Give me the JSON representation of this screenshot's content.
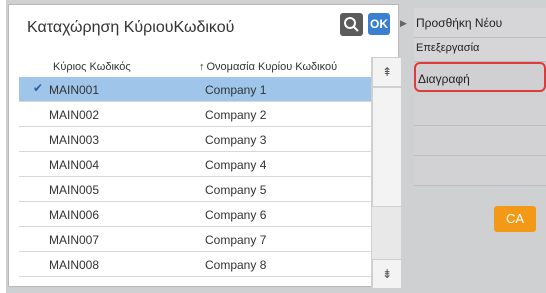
{
  "dialog": {
    "title": "Καταχώρηση ΚύριουΚωδικού",
    "ok_label": "OK"
  },
  "table": {
    "columns": [
      "Κύριος Κωδικός",
      "Ονομασία Κυρίου Κωδικού"
    ],
    "rows": [
      {
        "code": "MAIN001",
        "name": "Company 1",
        "selected": true
      },
      {
        "code": "MAIN002",
        "name": "Company 2",
        "selected": false
      },
      {
        "code": "MAIN003",
        "name": "Company 3",
        "selected": false
      },
      {
        "code": "MAIN004",
        "name": "Company 4",
        "selected": false
      },
      {
        "code": "MAIN005",
        "name": "Company 5",
        "selected": false
      },
      {
        "code": "MAIN006",
        "name": "Company 6",
        "selected": false
      },
      {
        "code": "MAIN007",
        "name": "Company 7",
        "selected": false
      },
      {
        "code": "MAIN008",
        "name": "Company 8",
        "selected": false
      }
    ]
  },
  "sidebar": {
    "items": [
      {
        "label": "Προσθήκη Νέου"
      },
      {
        "label": "Επεξεργασία"
      },
      {
        "label": "Διαγραφή"
      }
    ]
  },
  "actions": {
    "ca_label": "CA"
  },
  "colors": {
    "selected_row": "#9fc6ea",
    "ok_button": "#3a7fd0",
    "ca_button": "#f29a18",
    "highlight_border": "#e23a3a"
  },
  "icons": {
    "search": "search-icon",
    "ok": "ok-icon",
    "scroll_up": "scroll-up-icon",
    "scroll_down": "scroll-down-icon",
    "sort": "sort-icon",
    "check": "check-icon",
    "panel_arrow": "panel-arrow-icon"
  }
}
